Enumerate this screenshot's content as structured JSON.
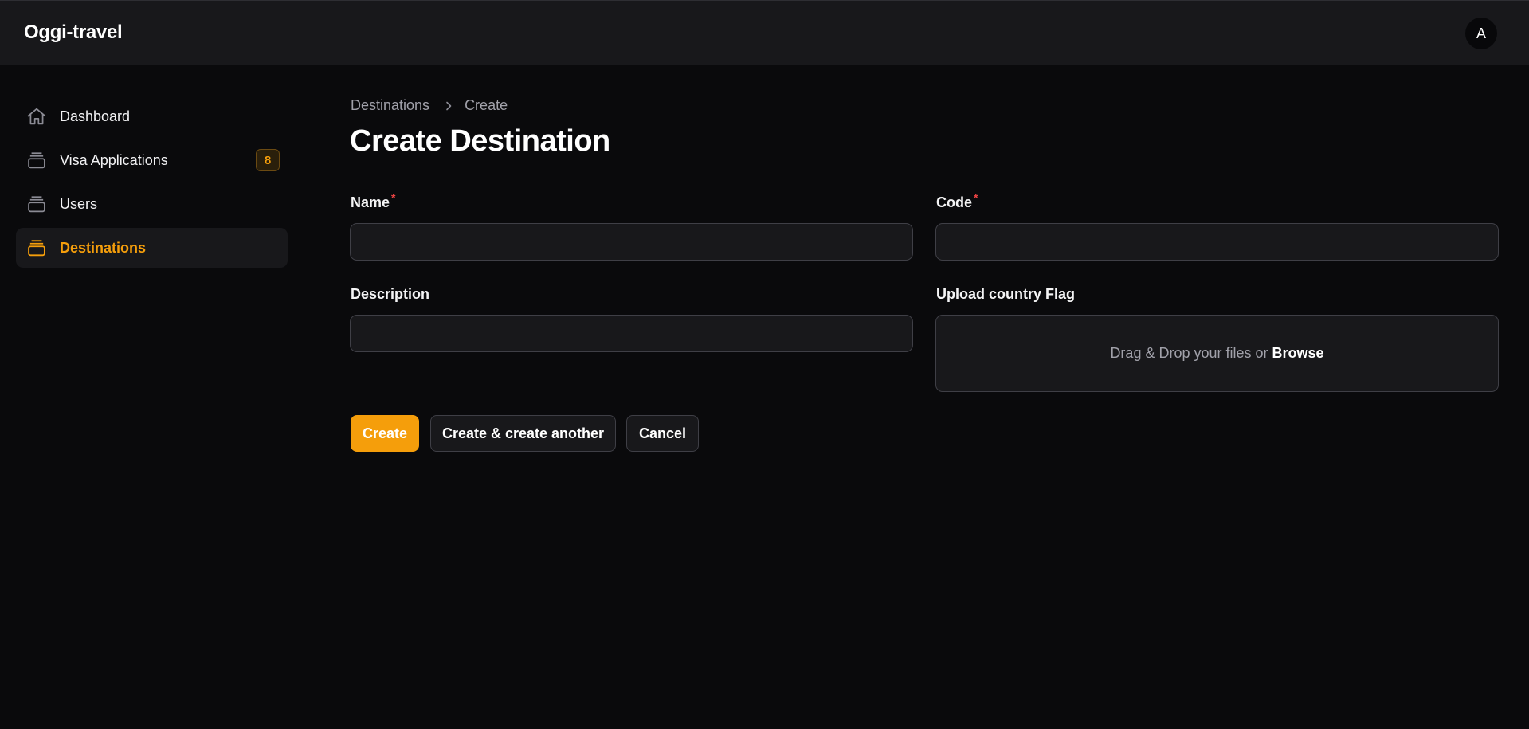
{
  "app": {
    "brand": "Oggi-travel",
    "avatar_initial": "A"
  },
  "sidebar": {
    "items": [
      {
        "label": "Dashboard",
        "icon": "home-icon",
        "active": false
      },
      {
        "label": "Visa Applications",
        "icon": "stack-icon",
        "badge": "8",
        "active": false
      },
      {
        "label": "Users",
        "icon": "stack-icon",
        "active": false
      },
      {
        "label": "Destinations",
        "icon": "stack-icon",
        "active": true
      }
    ]
  },
  "breadcrumb": {
    "items": [
      "Destinations",
      "Create"
    ],
    "separator_icon": "chevron-right-icon"
  },
  "page": {
    "title": "Create Destination"
  },
  "form": {
    "name": {
      "label": "Name",
      "required_mark": "*",
      "value": ""
    },
    "code": {
      "label": "Code",
      "required_mark": "*",
      "value": ""
    },
    "description": {
      "label": "Description",
      "value": ""
    },
    "flag_upload": {
      "label": "Upload country Flag",
      "prompt": "Drag & Drop your files or",
      "browse_label": "Browse"
    }
  },
  "actions": {
    "create_label": "Create",
    "create_another_label": "Create & create another",
    "cancel_label": "Cancel"
  },
  "colors": {
    "accent": "#f59e0b",
    "background": "#0a0a0c",
    "surface": "#18181b",
    "border": "#3f3f46",
    "required": "#ef4444"
  }
}
